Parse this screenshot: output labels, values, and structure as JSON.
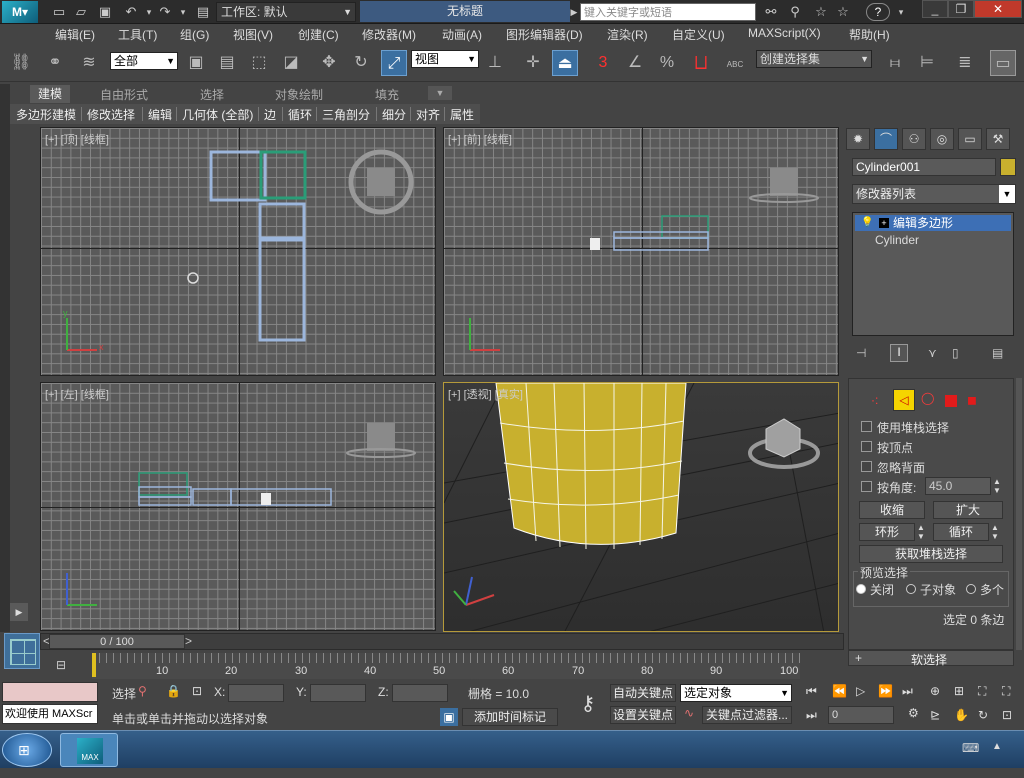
{
  "titlebar": {
    "workspace_label": "工作区: 默认",
    "doc_title": "无标题",
    "search_placeholder": "键入关键字或短语",
    "help_label": "?"
  },
  "menu": [
    "编辑(E)",
    "工具(T)",
    "组(G)",
    "视图(V)",
    "创建(C)",
    "修改器(M)",
    "动画(A)",
    "图形编辑器(D)",
    "渲染(R)",
    "自定义(U)",
    "MAXScript(X)",
    "帮助(H)"
  ],
  "toolbar": {
    "filter_value": "全部",
    "refcoord_value": "视图",
    "selection_set_placeholder": "创建选择集",
    "snap_3": "3",
    "snap_percent": "%",
    "snap_abc": "ABC"
  },
  "ribbon": {
    "tabs": [
      "建模",
      "自由形式",
      "选择",
      "对象绘制",
      "填充"
    ],
    "row": [
      "多边形建模",
      "修改选择",
      "编辑",
      "几何体 (全部)",
      "边",
      "循环",
      "三角剖分",
      "细分",
      "对齐",
      "属性"
    ]
  },
  "viewports": {
    "top": "[+] [顶] [线框]",
    "front": "[+] [前] [线框]",
    "left": "[+] [左] [线框]",
    "persp": "[+] [透视] [真实]",
    "axis_x": "x",
    "axis_y": "y",
    "axis_z": "z"
  },
  "command_panel": {
    "object_name": "Cylinder001",
    "modifier_list": "修改器列表",
    "stack": [
      "编辑多边形",
      "Cylinder"
    ],
    "options": {
      "use_stack": "使用堆栈选择",
      "by_vertex": "按顶点",
      "ignore_back": "忽略背面",
      "by_angle": "按角度:",
      "angle_value": "45.0"
    },
    "buttons": {
      "shrink": "收缩",
      "grow": "扩大",
      "ring": "环形",
      "loop": "循环",
      "get_stack": "获取堆栈选择"
    },
    "preview": {
      "title": "预览选择",
      "off": "关闭",
      "subobj": "子对象",
      "multi": "多个"
    },
    "selected_info": "选定 0 条边",
    "soft_select": "软选择"
  },
  "timeline": {
    "frame_display": "0 / 100",
    "ticks": [
      "10",
      "20",
      "30",
      "40",
      "50",
      "60",
      "70",
      "80",
      "90",
      "100"
    ]
  },
  "status": {
    "welcome": "欢迎使用 MAXScr",
    "selected_prefix": "选择",
    "x_label": "X:",
    "y_label": "Y:",
    "z_label": "Z:",
    "grid_info": "栅格 = 10.0",
    "auto_key": "自动关键点",
    "key_target": "选定对象",
    "set_key": "设置关键点",
    "key_filter": "关键点过滤器...",
    "frame_value": "0",
    "prompt": "单击或单击并拖动以选择对象",
    "add_time_tag": "添加时间标记"
  },
  "taskbar": {
    "app_label": "MAX"
  },
  "colors": {
    "viewport_bg": "#5a5a5a",
    "grid_line": "#868686",
    "selection_blue": "#3d6fb5",
    "cylinder_yellow": "#c8b02e",
    "active_viewport_border": "#b59a3a"
  }
}
